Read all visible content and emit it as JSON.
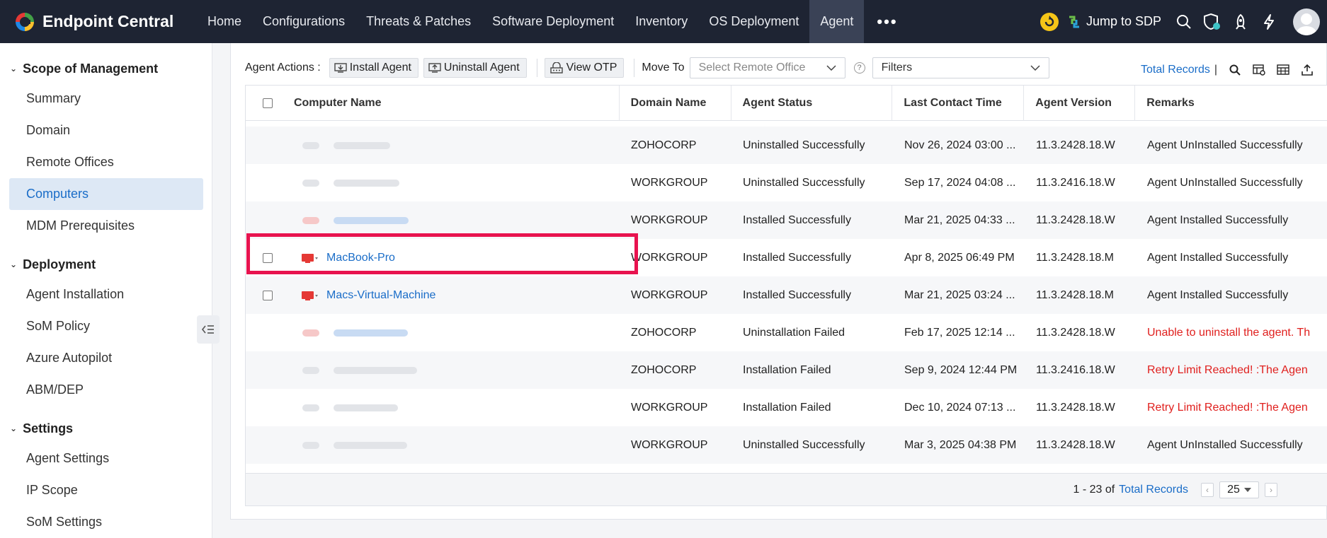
{
  "brand": {
    "name": "Endpoint Central",
    "logo_icon": "endpoint-central-logo"
  },
  "nav": {
    "items": [
      "Home",
      "Configurations",
      "Threats & Patches",
      "Software Deployment",
      "Inventory",
      "OS Deployment",
      "Agent"
    ],
    "active": "Agent",
    "more_label": "•••"
  },
  "topright": {
    "jump_label": "Jump to SDP"
  },
  "sidebar": {
    "sections": [
      {
        "title": "Scope of Management",
        "items": [
          "Summary",
          "Domain",
          "Remote Offices",
          "Computers",
          "MDM Prerequisites"
        ],
        "active": "Computers"
      },
      {
        "title": "Deployment",
        "items": [
          "Agent Installation",
          "SoM Policy",
          "Azure Autopilot",
          "ABM/DEP"
        ]
      },
      {
        "title": "Settings",
        "items": [
          "Agent Settings",
          "IP Scope",
          "SoM Settings"
        ]
      }
    ]
  },
  "toolbar": {
    "agent_actions_label": "Agent Actions :",
    "install_label": "Install Agent",
    "uninstall_label": "Uninstall Agent",
    "view_otp_label": "View OTP",
    "move_to_label": "Move To",
    "remote_office_placeholder": "Select Remote Office",
    "filters_label": "Filters",
    "total_records_label": "Total Records",
    "pipe": "|"
  },
  "table": {
    "columns": [
      "Computer Name",
      "Domain Name",
      "Agent Status",
      "Last Contact Time",
      "Agent Version",
      "Remarks"
    ],
    "rows": [
      {
        "name": "",
        "blurred": true,
        "icon": "gray",
        "domain": "ZOHOCORP",
        "status": "Uninstalled Successfully",
        "last": "Nov 26, 2024 03:00 ...",
        "version": "11.3.2428.18.W",
        "remarks": "Agent UnInstalled Successfully",
        "remark_error": false
      },
      {
        "name": "",
        "blurred": true,
        "icon": "gray",
        "domain": "WORKGROUP",
        "status": "Uninstalled Successfully",
        "last": "Sep 17, 2024 04:08 ...",
        "version": "11.3.2416.18.W",
        "remarks": "Agent UnInstalled Successfully",
        "remark_error": false
      },
      {
        "name": "",
        "blurred": true,
        "icon": "red",
        "domain": "WORKGROUP",
        "status": "Installed Successfully",
        "last": "Mar 21, 2025 04:33 ...",
        "version": "11.3.2428.18.W",
        "remarks": "Agent Installed Successfully",
        "remark_error": false
      },
      {
        "name": "MacBook-Pro",
        "blurred": false,
        "icon": "red",
        "domain": "WORKGROUP",
        "status": "Installed Successfully",
        "last": "Apr 8, 2025 06:49 PM",
        "version": "11.3.2428.18.M",
        "remarks": "Agent Installed Successfully",
        "remark_error": false
      },
      {
        "name": "Macs-Virtual-Machine",
        "blurred": false,
        "icon": "red",
        "domain": "WORKGROUP",
        "status": "Installed Successfully",
        "last": "Mar 21, 2025 03:24 ...",
        "version": "11.3.2428.18.M",
        "remarks": "Agent Installed Successfully",
        "remark_error": false
      },
      {
        "name": "",
        "blurred": true,
        "icon": "red",
        "domain": "ZOHOCORP",
        "status": "Uninstallation Failed",
        "last": "Feb 17, 2025 12:14 ...",
        "version": "11.3.2428.18.W",
        "remarks": "Unable to uninstall the agent. Th",
        "remark_error": true
      },
      {
        "name": "",
        "blurred": true,
        "icon": "gray",
        "domain": "ZOHOCORP",
        "status": "Installation Failed",
        "last": "Sep 9, 2024 12:44 PM",
        "version": "11.3.2416.18.W",
        "remarks": "Retry Limit Reached! :The Agen",
        "remark_error": true
      },
      {
        "name": "",
        "blurred": true,
        "icon": "gray",
        "domain": "WORKGROUP",
        "status": "Installation Failed",
        "last": "Dec 10, 2024 07:13 ...",
        "version": "11.3.2428.18.W",
        "remarks": "Retry Limit Reached! :The Agen",
        "remark_error": true
      },
      {
        "name": "",
        "blurred": true,
        "icon": "gray",
        "domain": "WORKGROUP",
        "status": "Uninstalled Successfully",
        "last": "Mar 3, 2025 04:38 PM",
        "version": "11.3.2428.18.W",
        "remarks": "Agent UnInstalled Successfully",
        "remark_error": false
      }
    ]
  },
  "footer": {
    "range": "1 - 23 of",
    "total_label": "Total Records",
    "page_size": "25",
    "prev": "‹",
    "next": "›"
  },
  "colors": {
    "topbar": "#1e2433",
    "accent": "#1a6dc8",
    "error": "#e0201e",
    "highlight": "#e8134f"
  }
}
